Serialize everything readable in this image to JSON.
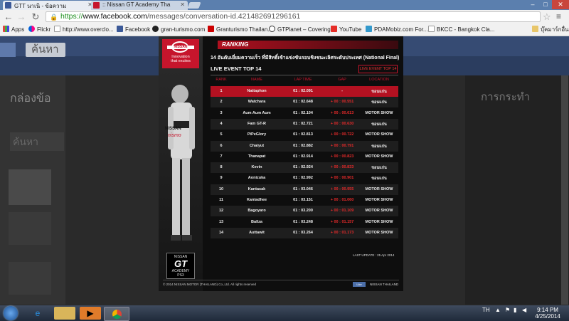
{
  "browser": {
    "tabs": [
      {
        "label": "GTT นาเนิ - ข้อความ",
        "active": true
      },
      {
        "label": ":: Nissan GT Academy Tha",
        "active": false
      }
    ],
    "window_controls": {
      "minimize": "–",
      "maximize": "□",
      "close": "✕"
    },
    "url_scheme": "https://",
    "url_host": "www.facebook.com",
    "url_path": "/messages/conversation-id.421482691296161",
    "bookmarks": [
      {
        "label": "Apps",
        "icon": "apps-grid-icon"
      },
      {
        "label": "Flickr",
        "icon": "flickr-icon"
      },
      {
        "label": "http://www.overclo...",
        "icon": "page-icon"
      },
      {
        "label": "Facebook",
        "icon": "facebook-icon"
      },
      {
        "label": "gran-turismo.com",
        "icon": "gt-icon"
      },
      {
        "label": "Granturismo Thailan...",
        "icon": "page-icon"
      },
      {
        "label": "GTPlanet – Covering...",
        "icon": "gtplanet-icon"
      },
      {
        "label": "YouTube",
        "icon": "youtube-icon"
      },
      {
        "label": "PDAMobiz.com For...",
        "icon": "pdamobiz-icon"
      },
      {
        "label": "BKCC - Bangkok Cla...",
        "icon": "page-icon"
      },
      {
        "label": "บุ๊คมาร์กอื่นๆ",
        "icon": "folder-icon"
      }
    ]
  },
  "facebook": {
    "search_text": "ค้นหา",
    "left_title": "กล่องข้อ",
    "right_title": "การกระทำ",
    "left_box": "ค้นหา"
  },
  "ranking": {
    "logo_brand": "NISSAN",
    "logo_tagline_1": "Innovation",
    "logo_tagline_2": "that excites",
    "header": "RANKING",
    "subtitle": "14 อันดับเยี่ยมความเร็ว ที่มีสิทธิ์เข้าแข่งขันรอบชิงชนะเลิศระดับประเทศ (National Final)",
    "event_title": "LIVE EVENT TOP 14",
    "event_button": "LIVE EVENT TOP 14",
    "columns": [
      "RANK",
      "NAME",
      "LAP TIME",
      "GAP",
      "LOCATION"
    ],
    "rows": [
      {
        "rank": "1",
        "name": "Nattaphon",
        "lap": "01 : 02.091",
        "gap": "-",
        "location": "ขอนแก่น"
      },
      {
        "rank": "2",
        "name": "Watchara",
        "lap": "01 : 02.648",
        "gap": "+ 00 : 00.551",
        "location": "ขอนแก่น"
      },
      {
        "rank": "3",
        "name": "Aum Aum Aum",
        "lap": "01 : 02.104",
        "gap": "+ 00 : 00.613",
        "location": "MOTOR SHOW"
      },
      {
        "rank": "4",
        "name": "Fam GT-R",
        "lap": "01 : 02.721",
        "gap": "+ 00 : 00.630",
        "location": "ขอนแก่น"
      },
      {
        "rank": "5",
        "name": "PiPeGlory",
        "lap": "01 : 02.813",
        "gap": "+ 00 : 00.722",
        "location": "MOTOR SHOW"
      },
      {
        "rank": "6",
        "name": "Chaiyut",
        "lap": "01 : 02.882",
        "gap": "+ 00 : 00.791",
        "location": "ขอนแก่น"
      },
      {
        "rank": "7",
        "name": "Thanapat",
        "lap": "01 : 02.914",
        "gap": "+ 00 : 00.823",
        "location": "MOTOR SHOW"
      },
      {
        "rank": "8",
        "name": "Kevin",
        "lap": "01 : 02.924",
        "gap": "+ 00 : 00.833",
        "location": "ขอนแก่น"
      },
      {
        "rank": "9",
        "name": "Aonizuka",
        "lap": "01 : 02.992",
        "gap": "+ 00 : 00.901",
        "location": "ขอนแก่น"
      },
      {
        "rank": "10",
        "name": "Kantasak",
        "lap": "01 : 03.046",
        "gap": "+ 00 : 00.955",
        "location": "MOTOR SHOW"
      },
      {
        "rank": "11",
        "name": "Kantadhee",
        "lap": "01 : 03.151",
        "gap": "+ 00 : 01.060",
        "location": "MOTOR SHOW"
      },
      {
        "rank": "12",
        "name": "Bagoyaro",
        "lap": "01 : 03.200",
        "gap": "+ 00 : 01.109",
        "location": "MOTOR SHOW"
      },
      {
        "rank": "13",
        "name": "Ballza",
        "lap": "01 : 03.248",
        "gap": "+ 00 : 01.157",
        "location": "MOTOR SHOW"
      },
      {
        "rank": "14",
        "name": "Auttawit",
        "lap": "01 : 03.264",
        "gap": "+ 00 : 01.173",
        "location": "MOTOR SHOW"
      }
    ],
    "last_update": "LAST UPDATE : 25 Apr 2014",
    "gt_brand": "NISSAN",
    "gt_academy": "ACADEMY",
    "gt_platform": "PS3",
    "copyright": "© 2014 NISSAN MOTOR (THAILAND) Co.,Ltd. All rights reserved",
    "like_label": "Like",
    "nissan_thailand": "NISSAN THAILAND"
  },
  "taskbar": {
    "lang": "TH",
    "time": "9:14 PM",
    "date": "4/25/2014"
  }
}
